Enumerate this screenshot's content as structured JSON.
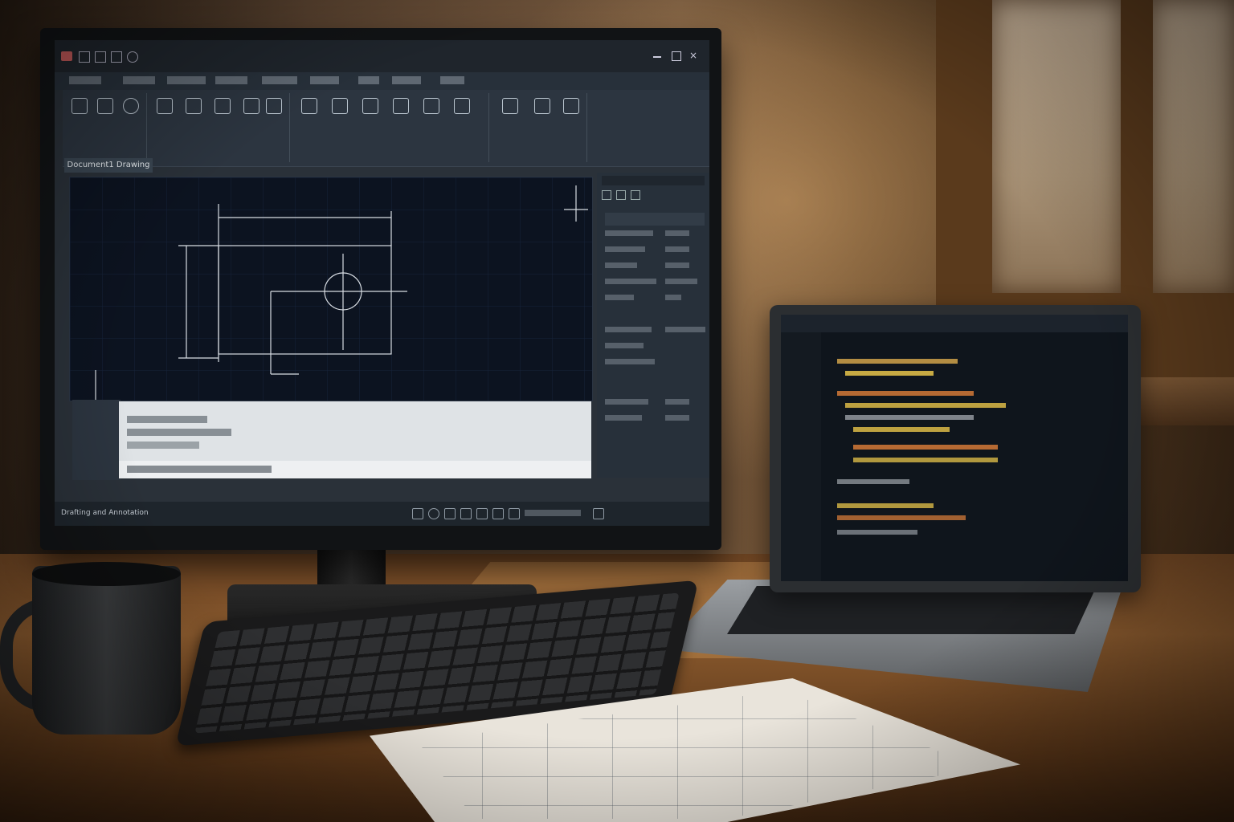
{
  "cad": {
    "filetab": "Document1 Drawing",
    "status_left": "Drafting and Annotation"
  },
  "colors": {
    "accent_code_yellow": "#e8c44a",
    "accent_code_orange": "#e0803a",
    "cad_bg": "#0c1320"
  }
}
